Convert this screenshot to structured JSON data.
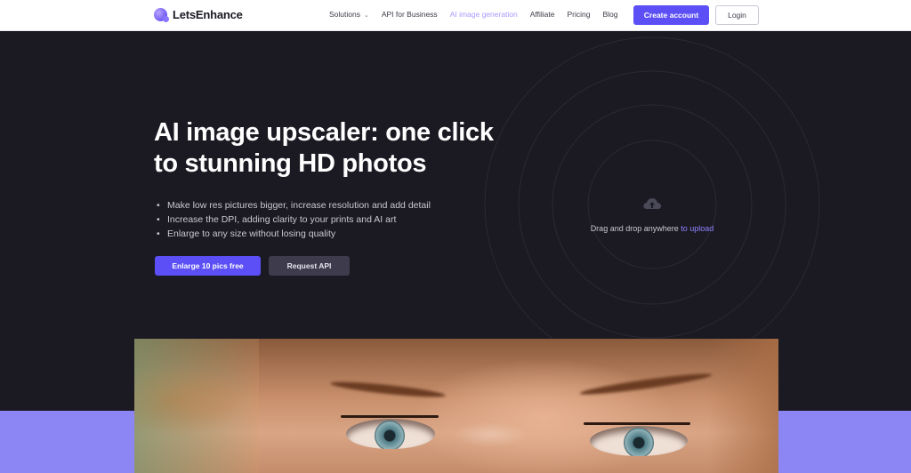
{
  "nav": {
    "logo_text": "LetsEnhance",
    "links": [
      {
        "label": "Solutions",
        "has_dropdown": true
      },
      {
        "label": "API for Business"
      },
      {
        "label": "AI image generation",
        "active": true
      },
      {
        "label": "Affiliate"
      },
      {
        "label": "Pricing"
      },
      {
        "label": "Blog"
      }
    ],
    "create_account": "Create account",
    "login": "Login"
  },
  "hero": {
    "headline_line1": "AI image upscaler: one click",
    "headline_line2": "to stunning HD photos",
    "bullets": [
      "Make low res pictures bigger, increase resolution and add detail",
      "Increase the DPI, adding clarity to your prints and AI art",
      "Enlarge to any size without losing quality"
    ],
    "primary_button": "Enlarge 10 pics free",
    "secondary_button": "Request API",
    "upload": {
      "icon": "cloud-upload-icon",
      "text": "Drag and drop anywhere",
      "link": "to upload"
    }
  },
  "colors": {
    "accent": "#5b4ff5",
    "hero_bg": "#1b1a23",
    "band": "#8b86f3",
    "link": "#8d83ff"
  }
}
